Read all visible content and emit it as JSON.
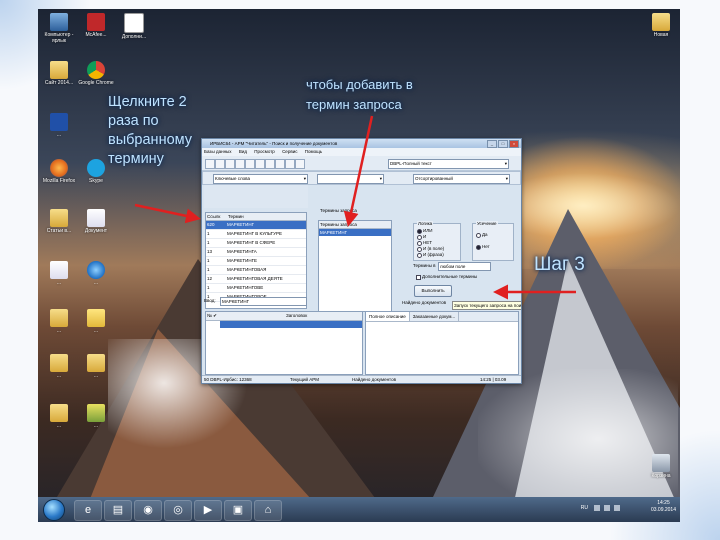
{
  "slide": {
    "annotation_left": "Щелкните 2\nраза по\nвыбранному\nтермину",
    "annotation_top": "чтобы добавить в\nтермин запроса",
    "annotation_step": "Шаг 3",
    "accent_arrow_color": "#e02020",
    "annotation_text_color": "#bfe3ff"
  },
  "desktop_icons": [
    {
      "name": "computer-icon",
      "label": "Компьютер - ярлык"
    },
    {
      "name": "antivirus-icon",
      "label": "McAfee..."
    },
    {
      "name": "browser-icon",
      "label": "Дополни..."
    },
    {
      "name": "folder-icon",
      "label": "Сайт 2014..."
    },
    {
      "name": "chrome-icon",
      "label": "Google Chrome"
    },
    {
      "name": "database-icon",
      "label": "..."
    },
    {
      "name": "firefox-icon",
      "label": "Mozilla Firefox"
    },
    {
      "name": "skype-icon",
      "label": "Skype"
    },
    {
      "name": "folder-icon",
      "label": "Статьи в..."
    },
    {
      "name": "document-icon",
      "label": "Документ"
    },
    {
      "name": "document-icon",
      "label": "..."
    },
    {
      "name": "ie-icon",
      "label": "..."
    },
    {
      "name": "folder-icon",
      "label": "..."
    },
    {
      "name": "folder-icon",
      "label": "..."
    },
    {
      "name": "folder-icon",
      "label": "..."
    },
    {
      "name": "folder-icon",
      "label": "..."
    },
    {
      "name": "folder-icon",
      "label": "..."
    },
    {
      "name": "folder-icon",
      "label": "..."
    },
    {
      "name": "folder-icon",
      "label": "Новая"
    },
    {
      "name": "recycle-bin-icon",
      "label": "Корзина"
    }
  ],
  "app": {
    "title": "ИРБИС64 - АРМ \"Читатель\" - Поиск и получение документов",
    "menu": [
      "Базы данных",
      "Вид",
      "Просмотр",
      "Сервис",
      "Помощь"
    ],
    "toolbar": {
      "db_select": "DBPL-Полный текст",
      "mode_select": "Отсортированный"
    },
    "search_dict_select": "Ключевые слова",
    "terms_table": {
      "headers": [
        "Ссылк",
        "Термин"
      ],
      "rows": [
        {
          "count": "620",
          "term": "МАРКЕТИНГ"
        },
        {
          "count": "1",
          "term": "МАРКЕТИНГ В КУЛЬТУРЕ"
        },
        {
          "count": "1",
          "term": "МАРКЕТИНГ В СФЕРЕ"
        },
        {
          "count": "13",
          "term": "МАРКЕТИНГА"
        },
        {
          "count": "1",
          "term": "МАРКЕТИНГЕ"
        },
        {
          "count": "1",
          "term": "МАРКЕТИНГОВАЯ"
        },
        {
          "count": "12",
          "term": "МАРКЕТИНГОВАЯ ДЕЯТЕ"
        },
        {
          "count": "1",
          "term": "МАРКЕТИНГОВЕ"
        },
        {
          "count": "1",
          "term": "МАРКЕТИНГОВОЕ"
        }
      ]
    },
    "search_field": {
      "label": "Ввод:",
      "value": "МАРКЕТИНГ"
    },
    "request_terms": {
      "label": "Термины запроса",
      "header": "Термины запроса",
      "selected": "МАРКЕТИНГ"
    },
    "logic_group": {
      "title": "Логика",
      "options": [
        "ИЛИ",
        "И",
        "НЕТ",
        "И (в поле)",
        "И (фраза)"
      ],
      "selected_index": 0
    },
    "truncation_group": {
      "title": "Усечение",
      "options": [
        "Да",
        "Нет"
      ],
      "selected_index": 1
    },
    "terms_in_label": "Термины в",
    "terms_in_value": "любом поле",
    "extra_terms_label": "Дополнительные термины",
    "execute_button": "Выполнить",
    "found_docs_label": "Найдено документов",
    "execute_hint": "Запуск текущего запроса на поиск",
    "bottom_left_header": "Заголовок",
    "tabs": [
      "Полное описание",
      "Заказанные докум..."
    ],
    "status": [
      "50 DBPL-Ирбис: 12368",
      "Текущий АРМ",
      "Найдено документов",
      "14:25 | 03.09"
    ]
  },
  "taskbar": {
    "pinned": [
      "ie-icon",
      "folder-icon",
      "firefox-icon",
      "chrome-icon",
      "media-icon",
      "irbis-icon",
      "app-icon"
    ],
    "language": "RU",
    "time": "14:25",
    "date": "03.09.2014"
  }
}
